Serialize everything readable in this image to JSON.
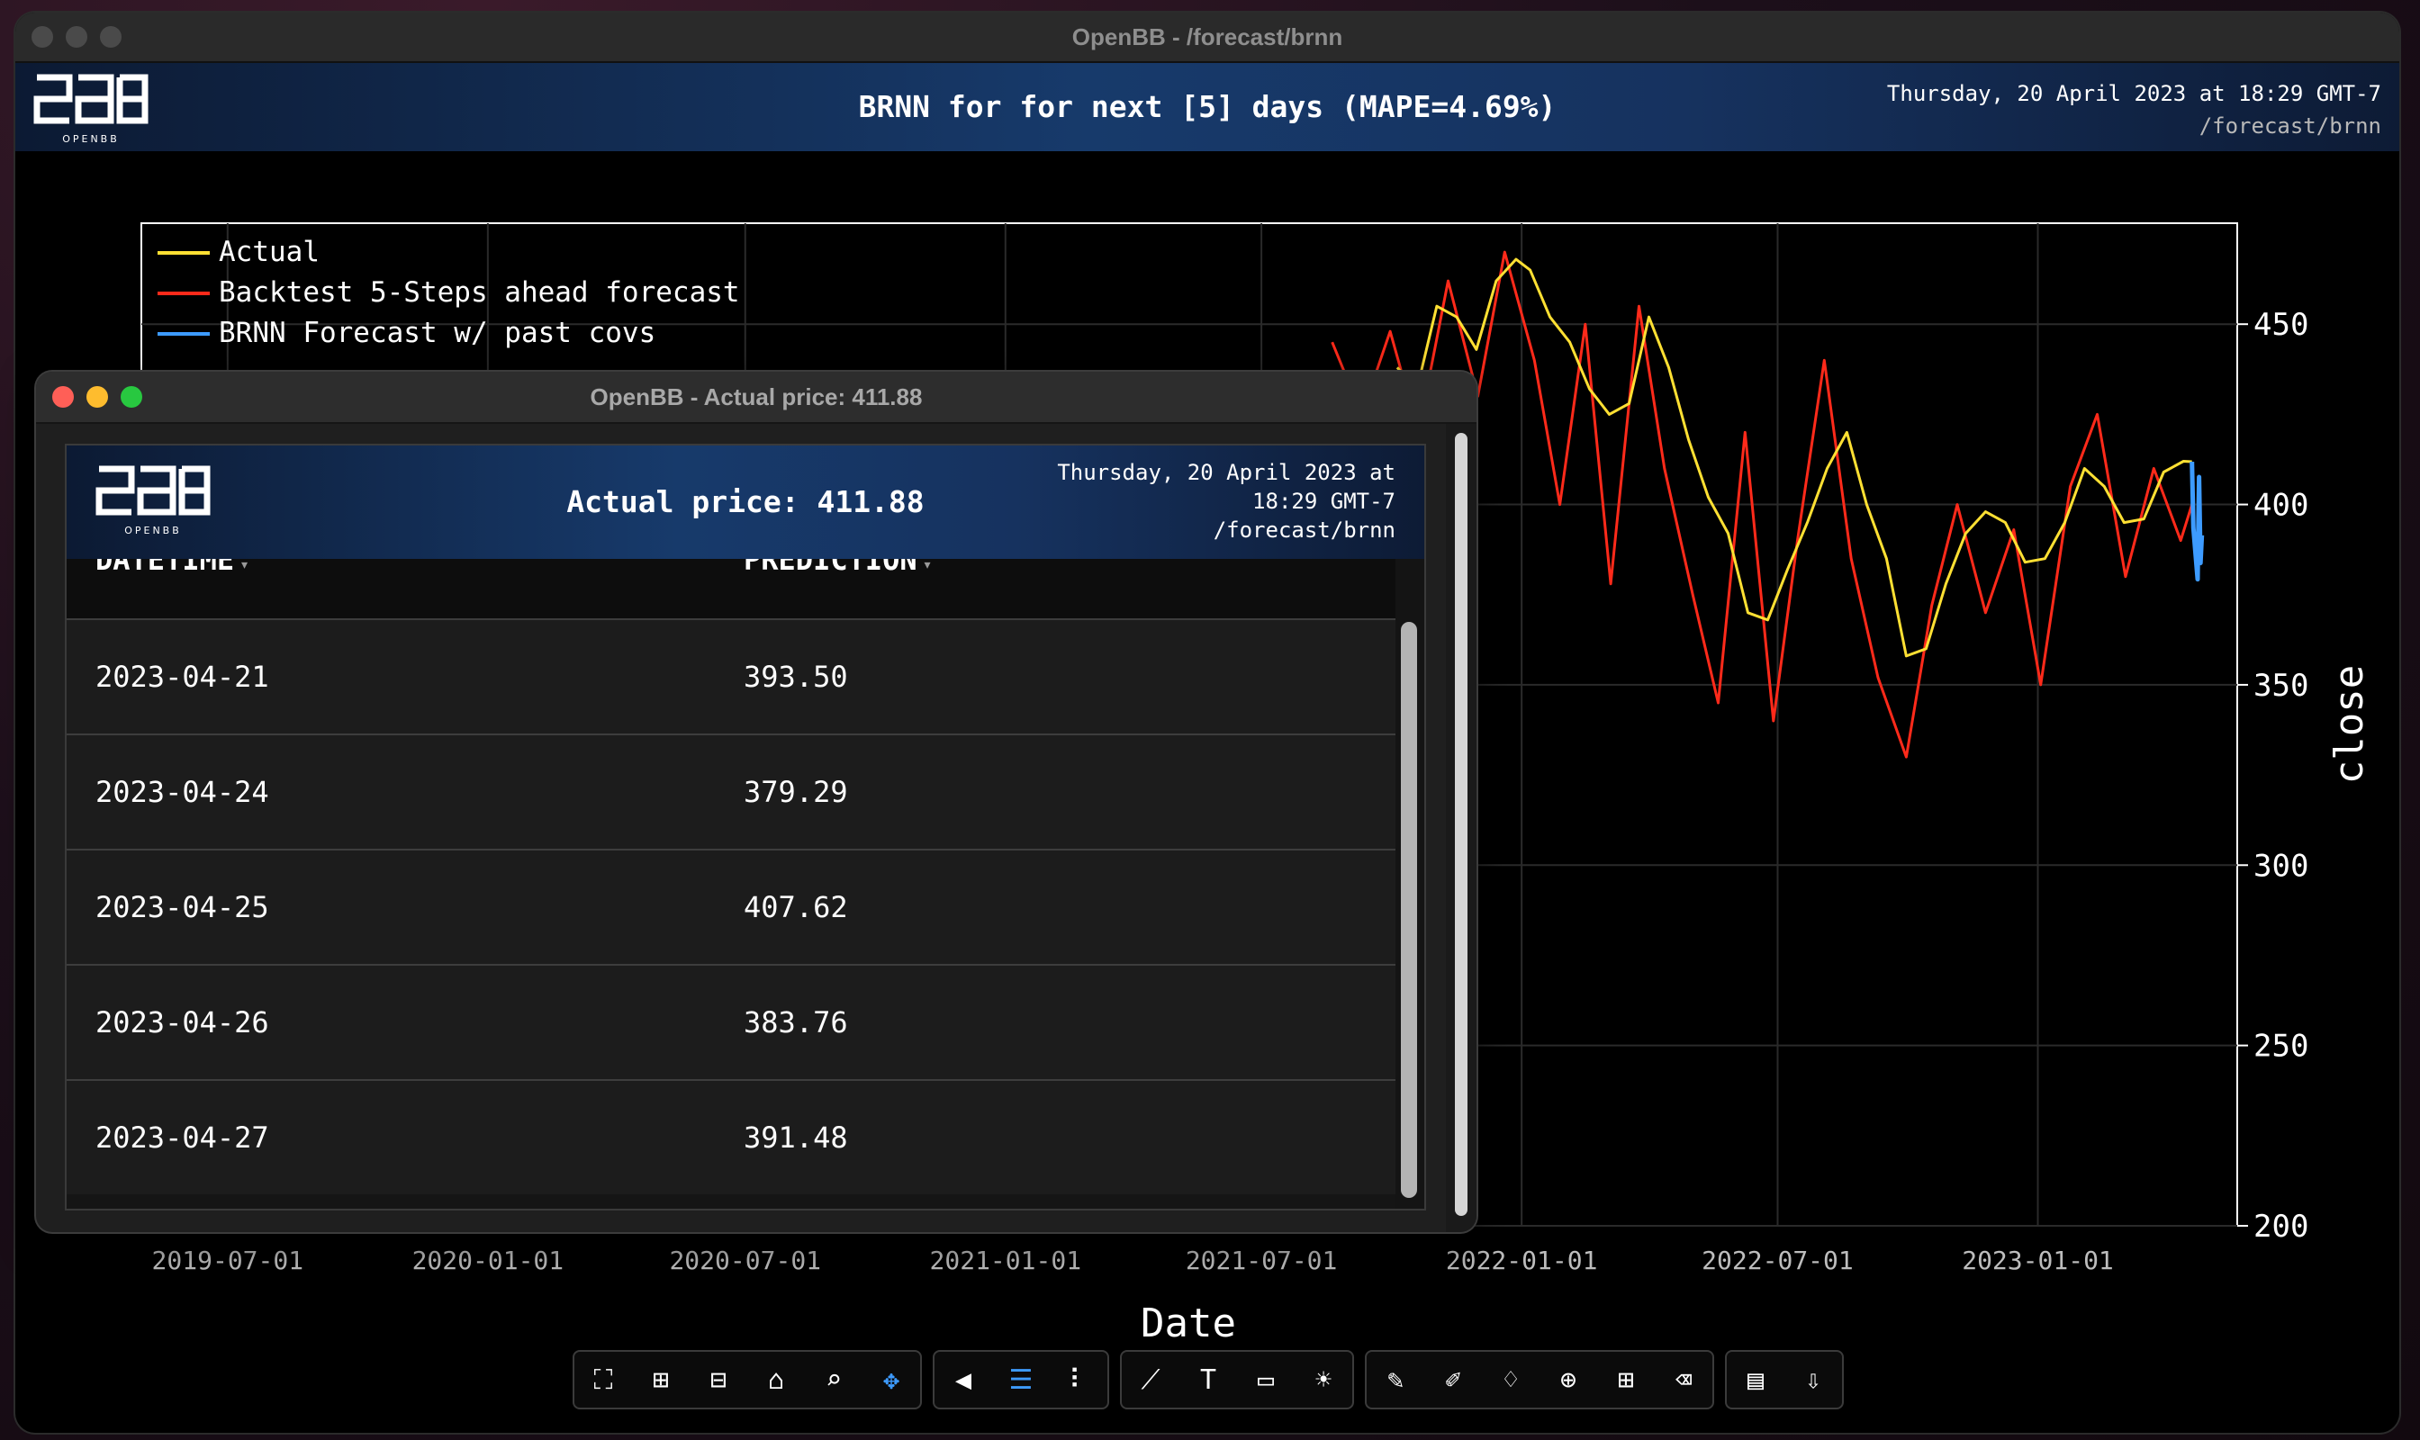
{
  "window": {
    "title": "OpenBB - /forecast/brnn"
  },
  "banner": {
    "logo_text": "OPENBB",
    "title": "BRNN for for next [5] days (MAPE=4.69%)",
    "datetime": "Thursday, 20 April 2023 at 18:29 GMT-7",
    "path": "/forecast/brnn"
  },
  "chart_data": {
    "type": "line",
    "title": "BRNN for for next [5] days (MAPE=4.69%)",
    "xlabel": "Date",
    "ylabel": "close",
    "x_ticks": [
      "2019-07-01",
      "2020-01-01",
      "2020-07-01",
      "2021-01-01",
      "2021-07-01",
      "2022-01-01",
      "2022-07-01",
      "2023-01-01"
    ],
    "y_ticks": [
      200,
      250,
      300,
      350,
      400,
      450
    ],
    "ylim": [
      200,
      478
    ],
    "xlim": [
      "2019-05-01",
      "2023-05-22"
    ],
    "grid": true,
    "legend_position": "top-left",
    "series": [
      {
        "name": "Actual",
        "color": "#ffe033",
        "points": [
          [
            "2021-10-05",
            438
          ],
          [
            "2021-10-19",
            432
          ],
          [
            "2021-11-02",
            455
          ],
          [
            "2021-11-16",
            452
          ],
          [
            "2021-11-30",
            443
          ],
          [
            "2021-12-14",
            462
          ],
          [
            "2021-12-28",
            468
          ],
          [
            "2022-01-07",
            465
          ],
          [
            "2022-01-21",
            452
          ],
          [
            "2022-02-04",
            445
          ],
          [
            "2022-02-18",
            432
          ],
          [
            "2022-03-04",
            425
          ],
          [
            "2022-03-18",
            428
          ],
          [
            "2022-04-01",
            452
          ],
          [
            "2022-04-15",
            438
          ],
          [
            "2022-04-29",
            418
          ],
          [
            "2022-05-13",
            402
          ],
          [
            "2022-05-27",
            392
          ],
          [
            "2022-06-10",
            370
          ],
          [
            "2022-06-24",
            368
          ],
          [
            "2022-07-08",
            382
          ],
          [
            "2022-07-22",
            395
          ],
          [
            "2022-08-05",
            410
          ],
          [
            "2022-08-19",
            420
          ],
          [
            "2022-09-02",
            400
          ],
          [
            "2022-09-16",
            385
          ],
          [
            "2022-09-30",
            358
          ],
          [
            "2022-10-14",
            360
          ],
          [
            "2022-10-28",
            378
          ],
          [
            "2022-11-11",
            392
          ],
          [
            "2022-11-25",
            398
          ],
          [
            "2022-12-09",
            395
          ],
          [
            "2022-12-23",
            384
          ],
          [
            "2023-01-06",
            385
          ],
          [
            "2023-01-20",
            395
          ],
          [
            "2023-02-03",
            410
          ],
          [
            "2023-02-17",
            405
          ],
          [
            "2023-03-03",
            395
          ],
          [
            "2023-03-17",
            396
          ],
          [
            "2023-03-31",
            409
          ],
          [
            "2023-04-14",
            412
          ],
          [
            "2023-04-20",
            411.88
          ]
        ]
      },
      {
        "name": "Backtest 5-Steps ahead forecast",
        "color": "#ff2a1a",
        "points": [
          [
            "2021-08-20",
            445
          ],
          [
            "2021-09-10",
            425
          ],
          [
            "2021-09-30",
            448
          ],
          [
            "2021-10-20",
            420
          ],
          [
            "2021-11-10",
            462
          ],
          [
            "2021-12-01",
            430
          ],
          [
            "2021-12-20",
            470
          ],
          [
            "2022-01-10",
            440
          ],
          [
            "2022-01-28",
            400
          ],
          [
            "2022-02-15",
            450
          ],
          [
            "2022-03-05",
            378
          ],
          [
            "2022-03-25",
            455
          ],
          [
            "2022-04-12",
            410
          ],
          [
            "2022-05-02",
            375
          ],
          [
            "2022-05-20",
            345
          ],
          [
            "2022-06-08",
            420
          ],
          [
            "2022-06-28",
            340
          ],
          [
            "2022-07-15",
            390
          ],
          [
            "2022-08-03",
            440
          ],
          [
            "2022-08-22",
            385
          ],
          [
            "2022-09-10",
            352
          ],
          [
            "2022-09-30",
            330
          ],
          [
            "2022-10-18",
            372
          ],
          [
            "2022-11-05",
            400
          ],
          [
            "2022-11-25",
            370
          ],
          [
            "2022-12-15",
            393
          ],
          [
            "2023-01-03",
            350
          ],
          [
            "2023-01-24",
            405
          ],
          [
            "2023-02-12",
            425
          ],
          [
            "2023-03-04",
            380
          ],
          [
            "2023-03-24",
            410
          ],
          [
            "2023-04-12",
            390
          ],
          [
            "2023-04-20",
            400
          ]
        ]
      },
      {
        "name": "BRNN Forecast w/ past covs",
        "color": "#3d9bff",
        "points": [
          [
            "2023-04-20",
            411.88
          ],
          [
            "2023-04-21",
            393.5
          ],
          [
            "2023-04-24",
            379.29
          ],
          [
            "2023-04-25",
            407.62
          ],
          [
            "2023-04-26",
            383.76
          ],
          [
            "2023-04-27",
            391.48
          ]
        ]
      }
    ]
  },
  "toolbar": {
    "groups": [
      [
        {
          "name": "autoscale-icon",
          "glyph": "⛶"
        },
        {
          "name": "zoom-in-icon",
          "glyph": "⊞"
        },
        {
          "name": "zoom-out-icon",
          "glyph": "⊟"
        },
        {
          "name": "home-icon",
          "glyph": "⌂"
        },
        {
          "name": "zoom-box-icon",
          "glyph": "⌕"
        },
        {
          "name": "pan-icon",
          "glyph": "✥"
        }
      ],
      [
        {
          "name": "hover-closest-icon",
          "glyph": "◀"
        },
        {
          "name": "hover-compare-icon",
          "glyph": "☰"
        },
        {
          "name": "spike-lines-icon",
          "glyph": "⠇"
        }
      ],
      [
        {
          "name": "chart-type-icon",
          "glyph": "⟋"
        },
        {
          "name": "text-icon",
          "glyph": "T"
        },
        {
          "name": "title-icon",
          "glyph": "▭"
        },
        {
          "name": "theme-icon",
          "glyph": "☀"
        }
      ],
      [
        {
          "name": "paint-icon",
          "glyph": "✎"
        },
        {
          "name": "draw-line-icon",
          "glyph": "✐"
        },
        {
          "name": "draw-open-path-icon",
          "glyph": "♢"
        },
        {
          "name": "draw-circle-icon",
          "glyph": "⊕"
        },
        {
          "name": "draw-rect-icon",
          "glyph": "⊞"
        },
        {
          "name": "erase-shape-icon",
          "glyph": "⌫"
        }
      ],
      [
        {
          "name": "download-csv-icon",
          "glyph": "▤"
        },
        {
          "name": "download-image-icon",
          "glyph": "⇩"
        }
      ]
    ]
  },
  "popup": {
    "title": "OpenBB - Actual price: 411.88",
    "banner": {
      "title": "Actual price: 411.88",
      "datetime_line1": "Thursday, 20 April 2023 at",
      "datetime_line2": "18:29 GMT-7",
      "path": "/forecast/brnn"
    },
    "columns": [
      "DATETIME",
      "PREDICTION"
    ],
    "rows": [
      {
        "datetime": "2023-04-21",
        "prediction": "393.50"
      },
      {
        "datetime": "2023-04-24",
        "prediction": "379.29"
      },
      {
        "datetime": "2023-04-25",
        "prediction": "407.62"
      },
      {
        "datetime": "2023-04-26",
        "prediction": "383.76"
      },
      {
        "datetime": "2023-04-27",
        "prediction": "391.48"
      }
    ]
  }
}
